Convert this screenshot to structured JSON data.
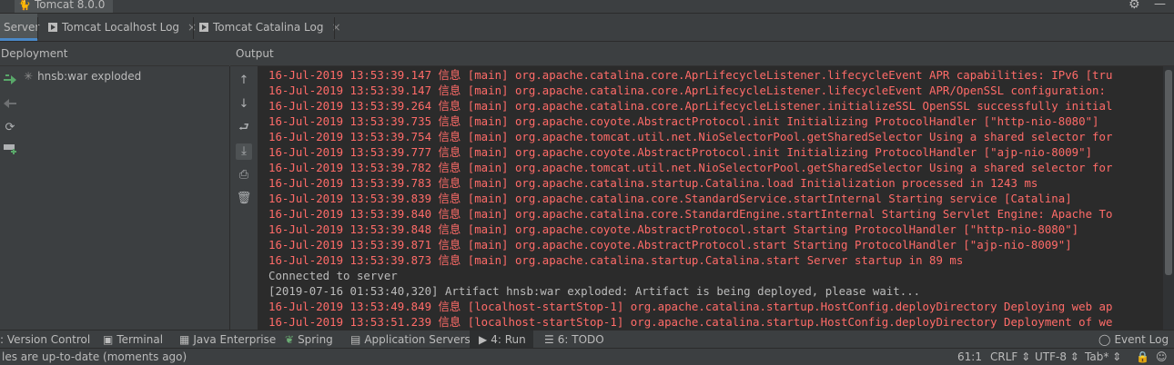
{
  "title": {
    "window_tab": "Tomcat 8.0.0"
  },
  "tabs": [
    {
      "label": "Server"
    },
    {
      "label": "Tomcat Localhost Log"
    },
    {
      "label": "Tomcat Catalina Log"
    }
  ],
  "deployment": {
    "header": "Deployment",
    "items": [
      {
        "label": "hnsb:war exploded"
      }
    ]
  },
  "output": {
    "header": "Output"
  },
  "console": {
    "lines": [
      {
        "text": "16-Jul-2019 13:53:39.147 信息 [main] org.apache.catalina.core.AprLifecycleListener.lifecycleEvent APR capabilities: IPv6 [tru",
        "color": "#ff6b68"
      },
      {
        "text": "16-Jul-2019 13:53:39.147 信息 [main] org.apache.catalina.core.AprLifecycleListener.lifecycleEvent APR/OpenSSL configuration:",
        "color": "#ff6b68"
      },
      {
        "text": "16-Jul-2019 13:53:39.264 信息 [main] org.apache.catalina.core.AprLifecycleListener.initializeSSL OpenSSL successfully initial",
        "color": "#ff6b68"
      },
      {
        "text": "16-Jul-2019 13:53:39.735 信息 [main] org.apache.coyote.AbstractProtocol.init Initializing ProtocolHandler [\"http-nio-8080\"]",
        "color": "#ff6b68"
      },
      {
        "text": "16-Jul-2019 13:53:39.754 信息 [main] org.apache.tomcat.util.net.NioSelectorPool.getSharedSelector Using a shared selector for",
        "color": "#ff6b68"
      },
      {
        "text": "16-Jul-2019 13:53:39.777 信息 [main] org.apache.coyote.AbstractProtocol.init Initializing ProtocolHandler [\"ajp-nio-8009\"]",
        "color": "#ff6b68"
      },
      {
        "text": "16-Jul-2019 13:53:39.782 信息 [main] org.apache.tomcat.util.net.NioSelectorPool.getSharedSelector Using a shared selector for",
        "color": "#ff6b68"
      },
      {
        "text": "16-Jul-2019 13:53:39.783 信息 [main] org.apache.catalina.startup.Catalina.load Initialization processed in 1243 ms",
        "color": "#ff6b68"
      },
      {
        "text": "16-Jul-2019 13:53:39.839 信息 [main] org.apache.catalina.core.StandardService.startInternal Starting service [Catalina]",
        "color": "#ff6b68"
      },
      {
        "text": "16-Jul-2019 13:53:39.840 信息 [main] org.apache.catalina.core.StandardEngine.startInternal Starting Servlet Engine: Apache To",
        "color": "#ff6b68"
      },
      {
        "text": "16-Jul-2019 13:53:39.848 信息 [main] org.apache.coyote.AbstractProtocol.start Starting ProtocolHandler [\"http-nio-8080\"]",
        "color": "#ff6b68"
      },
      {
        "text": "16-Jul-2019 13:53:39.871 信息 [main] org.apache.coyote.AbstractProtocol.start Starting ProtocolHandler [\"ajp-nio-8009\"]",
        "color": "#ff6b68"
      },
      {
        "text": "16-Jul-2019 13:53:39.873 信息 [main] org.apache.catalina.startup.Catalina.start Server startup in 89 ms",
        "color": "#ff6b68"
      },
      {
        "text": "Connected to server",
        "color": "#bbbbbb"
      },
      {
        "text": "[2019-07-16 01:53:40,320] Artifact hnsb:war exploded: Artifact is being deployed, please wait...",
        "color": "#bbbbbb"
      },
      {
        "text": "16-Jul-2019 13:53:49.849 信息 [localhost-startStop-1] org.apache.catalina.startup.HostConfig.deployDirectory Deploying web ap",
        "color": "#ff6b68"
      },
      {
        "text": "16-Jul-2019 13:53:51.239 信息 [localhost-startStop-1] org.apache.catalina.startup.HostConfig.deployDirectory Deployment of we",
        "color": "#ff6b68"
      }
    ]
  },
  "bottom_tabs": [
    {
      "label": ": Version Control"
    },
    {
      "label": "Terminal"
    },
    {
      "label": "Java Enterprise"
    },
    {
      "label": "Spring"
    },
    {
      "label": "Application Servers"
    },
    {
      "label": "4: Run"
    },
    {
      "label": "6: TODO"
    },
    {
      "label": "Event Log"
    }
  ],
  "status": {
    "message": "les are up-to-date (moments ago)",
    "position": "61:1",
    "line_sep": "CRLF ⇕",
    "encoding": "UTF-8 ⇕",
    "indent": "Tab* ⇕"
  },
  "colors": {
    "accent": "#4a88c7",
    "log_red": "#ff6b68",
    "console_bg": "#2b2b2b",
    "panel_bg": "#3c3f41",
    "green": "#59a869"
  }
}
